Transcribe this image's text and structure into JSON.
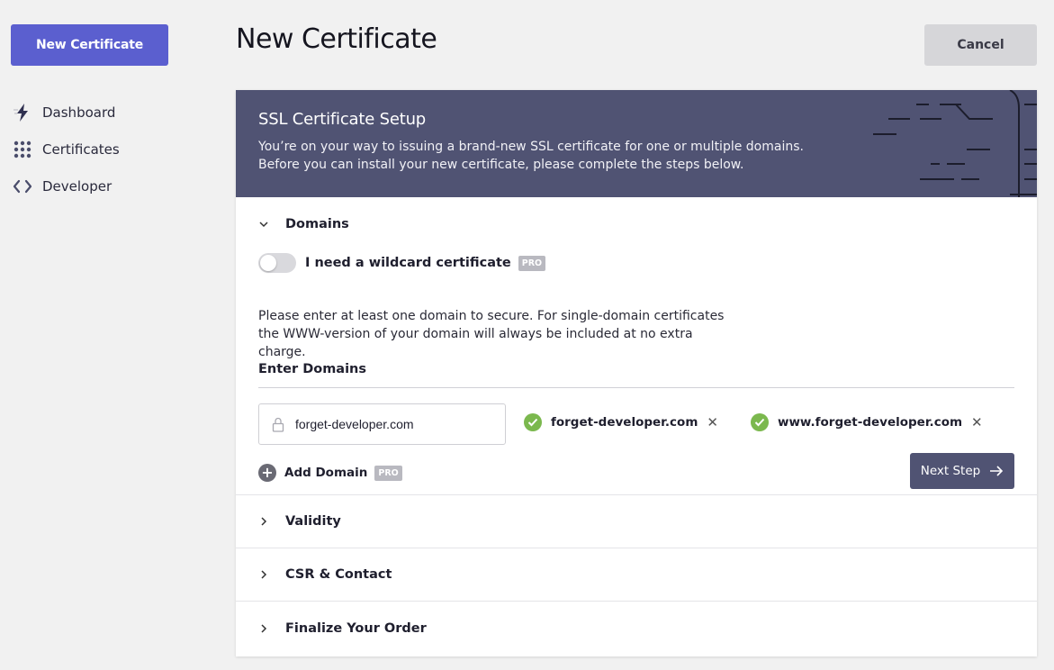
{
  "sidebar": {
    "new_certificate_label": "New Certificate",
    "items": [
      {
        "label": "Dashboard",
        "icon": "bolt-icon"
      },
      {
        "label": "Certificates",
        "icon": "grid-icon"
      },
      {
        "label": "Developer",
        "icon": "code-icon"
      }
    ]
  },
  "header": {
    "title": "New Certificate",
    "cancel_label": "Cancel"
  },
  "banner": {
    "title": "SSL Certificate Setup",
    "description": "You’re on your way to issuing a brand-new SSL certificate for one or multiple domains. Before you can install your new certificate, please complete the steps below."
  },
  "domains_section": {
    "title": "Domains",
    "wildcard_label": "I need a wildcard certificate",
    "wildcard_enabled": false,
    "pro_badge": "PRO",
    "help_text": "Please enter at least one domain to secure. For single-domain certificates the WWW-version of your domain will always be included at no extra charge.",
    "enter_label": "Enter Domains",
    "input_value": "forget-developer.com",
    "added_domains": [
      "forget-developer.com",
      "www.forget-developer.com"
    ],
    "add_domain_label": "Add Domain",
    "next_label": "Next Step"
  },
  "collapsed_sections": [
    {
      "title": "Validity"
    },
    {
      "title": "CSR & Contact"
    },
    {
      "title": "Finalize Your Order"
    }
  ],
  "colors": {
    "primary": "#5b5fcf",
    "banner": "#505373",
    "success": "#7bb84e",
    "background": "#f1f1f1"
  }
}
